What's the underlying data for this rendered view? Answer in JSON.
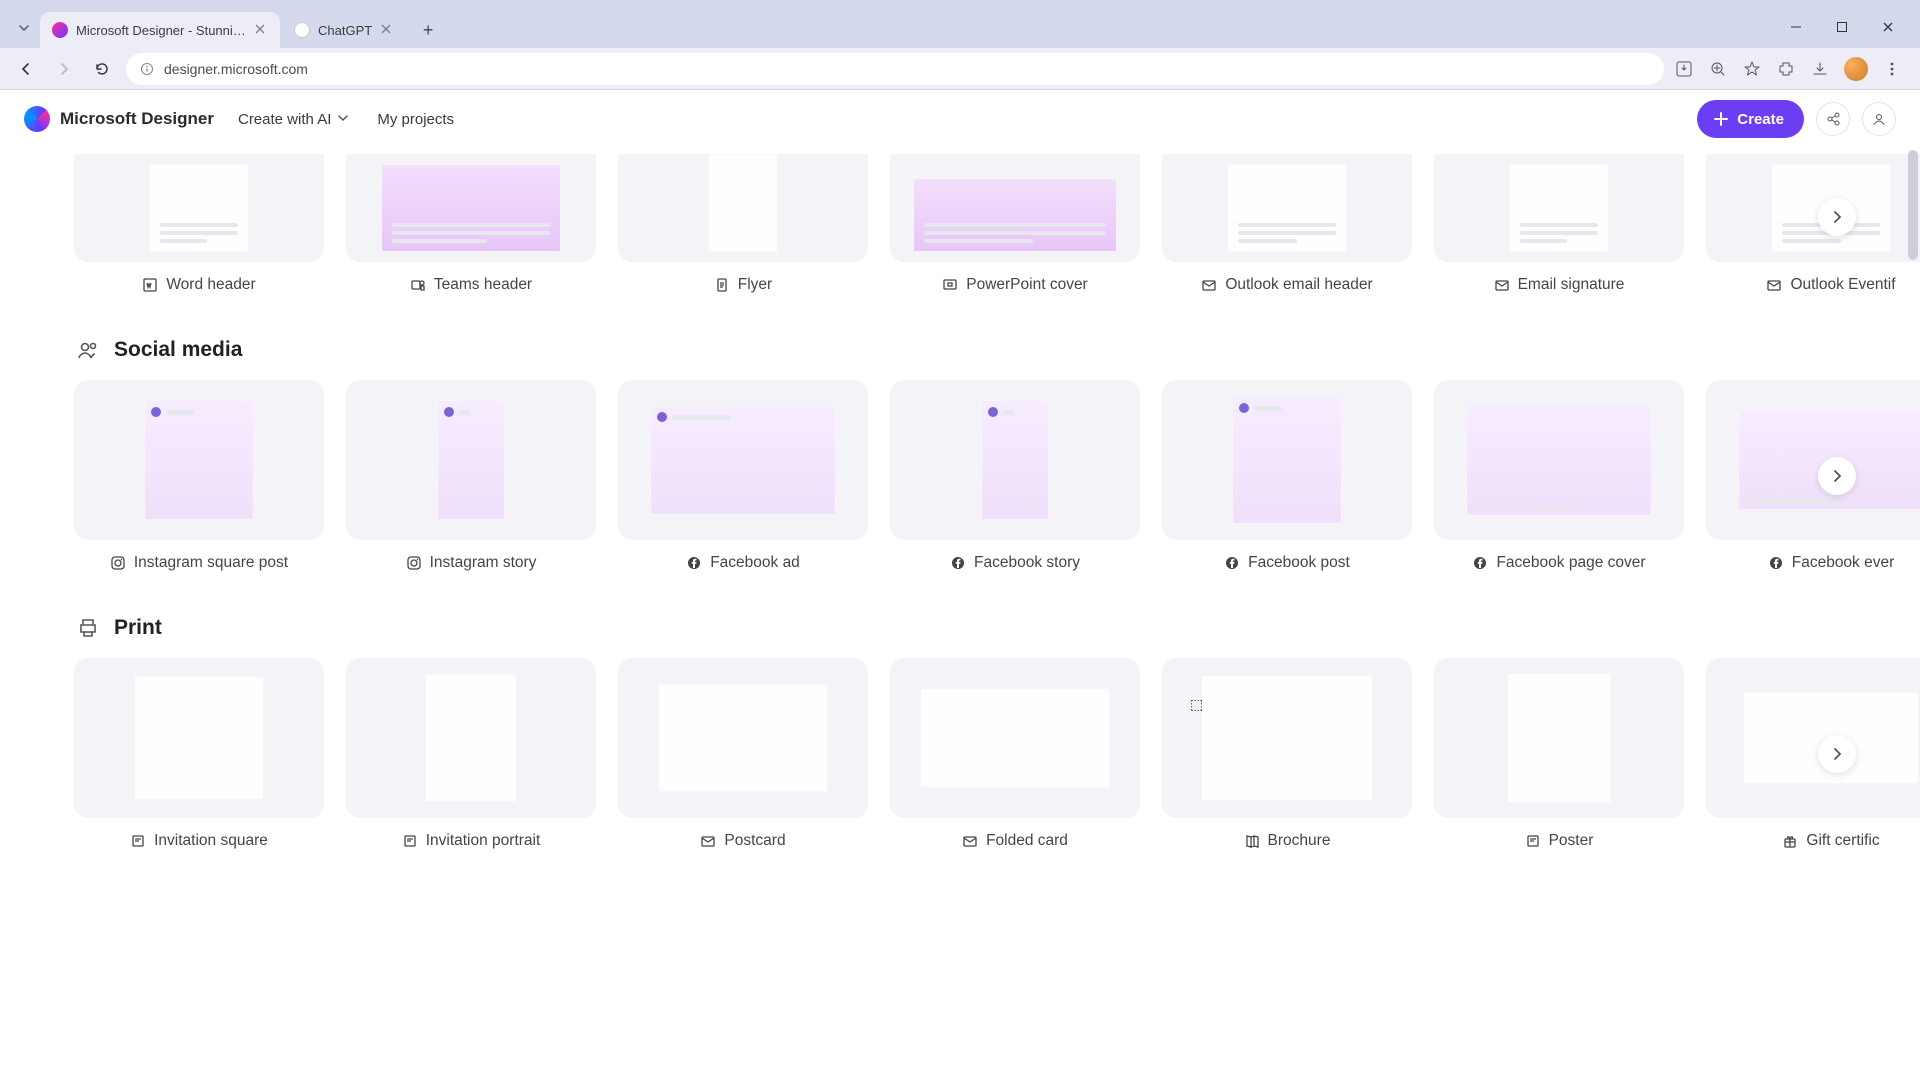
{
  "browser": {
    "tabs": [
      {
        "label": "Microsoft Designer - Stunning",
        "active": true
      },
      {
        "label": "ChatGPT",
        "active": false
      }
    ],
    "url": "designer.microsoft.com"
  },
  "header": {
    "brand": "Microsoft Designer",
    "create_with_ai": "Create with AI",
    "my_projects": "My projects",
    "create_button": "Create"
  },
  "sections": {
    "top": {
      "items": [
        {
          "label": "Word header",
          "icon": "word"
        },
        {
          "label": "Teams header",
          "icon": "teams"
        },
        {
          "label": "Flyer",
          "icon": "doc"
        },
        {
          "label": "PowerPoint cover",
          "icon": "ppt"
        },
        {
          "label": "Outlook email header",
          "icon": "outlook"
        },
        {
          "label": "Email signature",
          "icon": "mail"
        },
        {
          "label": "Outlook Eventif",
          "icon": "outlook"
        }
      ]
    },
    "social": {
      "title": "Social media",
      "items": [
        {
          "label": "Instagram square post",
          "icon": "instagram"
        },
        {
          "label": "Instagram story",
          "icon": "instagram"
        },
        {
          "label": "Facebook ad",
          "icon": "facebook"
        },
        {
          "label": "Facebook story",
          "icon": "facebook"
        },
        {
          "label": "Facebook post",
          "icon": "facebook"
        },
        {
          "label": "Facebook page cover",
          "icon": "facebook"
        },
        {
          "label": "Facebook ever",
          "icon": "facebook"
        }
      ]
    },
    "print": {
      "title": "Print",
      "items": [
        {
          "label": "Invitation square",
          "icon": "card"
        },
        {
          "label": "Invitation portrait",
          "icon": "card"
        },
        {
          "label": "Postcard",
          "icon": "mail"
        },
        {
          "label": "Folded card",
          "icon": "mail"
        },
        {
          "label": "Brochure",
          "icon": "brochure"
        },
        {
          "label": "Poster",
          "icon": "card"
        },
        {
          "label": "Gift certific",
          "icon": "gift"
        }
      ]
    }
  }
}
